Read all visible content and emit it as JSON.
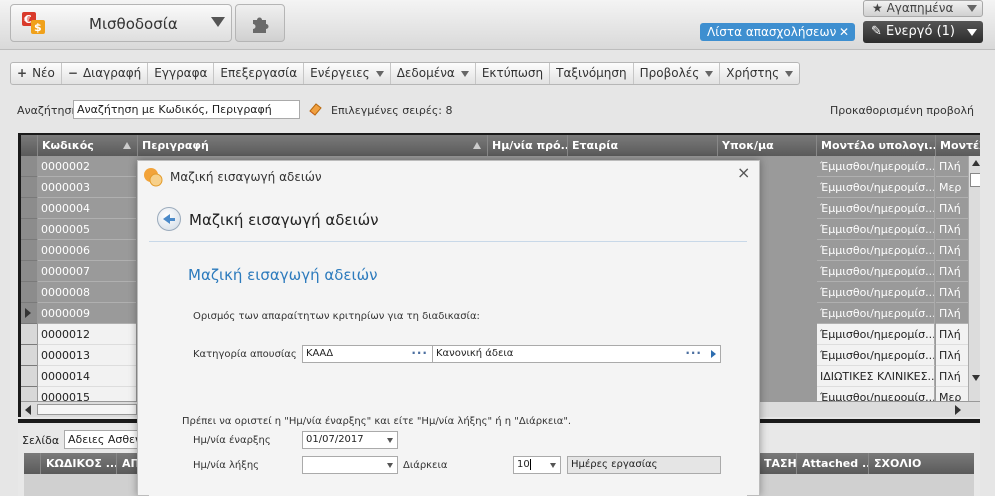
{
  "header": {
    "app_title": "Μισθοδοσία",
    "favorites_label": "Αγαπημένα",
    "list_chip_label": "Λίστα απασχολήσεων",
    "active_label": "Ενεργό (1)"
  },
  "toolbar": {
    "items": [
      {
        "label": "Νέο",
        "glyph": "+"
      },
      {
        "label": "Διαγραφή",
        "glyph": "−"
      },
      {
        "label": "Εγγραφα"
      },
      {
        "label": "Επεξεργασία"
      },
      {
        "label": "Ενέργειες",
        "dropdown": true
      },
      {
        "label": "Δεδομένα",
        "dropdown": true
      },
      {
        "label": "Εκτύπωση"
      },
      {
        "label": "Ταξινόμηση"
      },
      {
        "label": "Προβολές",
        "dropdown": true
      },
      {
        "label": "Χρήστης",
        "dropdown": true
      }
    ]
  },
  "search": {
    "label": "Αναζήτηση",
    "value": "Αναζήτηση με Κωδικός, Περιγραφή",
    "selected_rows": "Επιλεγμένες σειρές: 8",
    "preset_view": "Προκαθορισμένη προβολή"
  },
  "grid": {
    "headers": [
      "Κωδικός",
      "Περιγραφή",
      "Ημ/νία πρό...",
      "Εταιρία",
      "Υποκ/μα",
      "Μοντέλο υπολογι...",
      "Μοντέλ"
    ],
    "rows": [
      {
        "code": "0000002",
        "model": "Έμμισθοι/ημερομίσ...",
        "model2": "Πλή",
        "selected": true
      },
      {
        "code": "0000003",
        "model": "Έμμισθοι/ημερομίσ...",
        "model2": "Μερ",
        "selected": true
      },
      {
        "code": "0000004",
        "model": "Έμμισθοι/ημερομίσ...",
        "model2": "Πλή",
        "selected": true
      },
      {
        "code": "0000005",
        "model": "Έμμισθοι/ημερομίσ...",
        "model2": "Πλή",
        "selected": true
      },
      {
        "code": "0000006",
        "model": "Έμμισθοι/ημερομίσ...",
        "model2": "Πλή",
        "selected": true
      },
      {
        "code": "0000007",
        "model": "Έμμισθοι/ημερομίσ...",
        "model2": "Πλή",
        "selected": true
      },
      {
        "code": "0000008",
        "model": "Έμμισθοι/ημερομίσ...",
        "model2": "Πλή",
        "selected": true
      },
      {
        "code": "0000009",
        "model": "Έμμισθοι/ημερομίσ...",
        "model2": "Πλή",
        "selected": true,
        "current": true
      },
      {
        "code": "0000012",
        "model": "Έμμισθοι/ημερομίσ...",
        "model2": "Πλή",
        "selected": false
      },
      {
        "code": "0000013",
        "model": "Έμμισθοι/ημερομίσ...",
        "model2": "Πλή",
        "selected": false
      },
      {
        "code": "0000014",
        "model": "ΙΔΙΩΤΙΚΕΣ ΚΛΙΝΙΚΕΣ...",
        "model2": "Πλή",
        "selected": false
      },
      {
        "code": "0000015",
        "model": "Έμμισθοι/ημερομίσ...",
        "model2": "Μερ",
        "selected": false
      }
    ]
  },
  "lower": {
    "page_label": "Σελίδα",
    "page_value": "Αδειες Ασθενείας",
    "headers": [
      "ΚΩΔΙΚΟΣ ...",
      "ΑΠ",
      "ΤΑΣΗ",
      "Attached ...",
      "ΣΧΟΛΙΟ"
    ]
  },
  "modal": {
    "window_title": "Μαζική εισαγωγή αδειών",
    "header_title": "Μαζική εισαγωγή αδειών",
    "section_title": "Μαζική εισαγωγή αδειών",
    "instructions": "Ορισμός των απαραίτητων κριτηρίων για τη διαδικασία:",
    "absence_label": "Κατηγορία απουσίας",
    "absence_code": "ΚΑΑΔ",
    "absence_desc": "Κανονική άδεια",
    "rule_note": "Πρέπει να οριστεί η \"Ημ/νία έναρξης\" και είτε \"Ημ/νία λήξης\" ή η \"Διάρκεια\".",
    "start_label": "Ημ/νία έναρξης",
    "start_value": "01/07/2017",
    "end_label": "Ημ/νία λήξης",
    "end_value": "",
    "duration_label": "Διάρκεια",
    "duration_value": "10",
    "duration_unit": "Ημέρες εργασίας"
  }
}
